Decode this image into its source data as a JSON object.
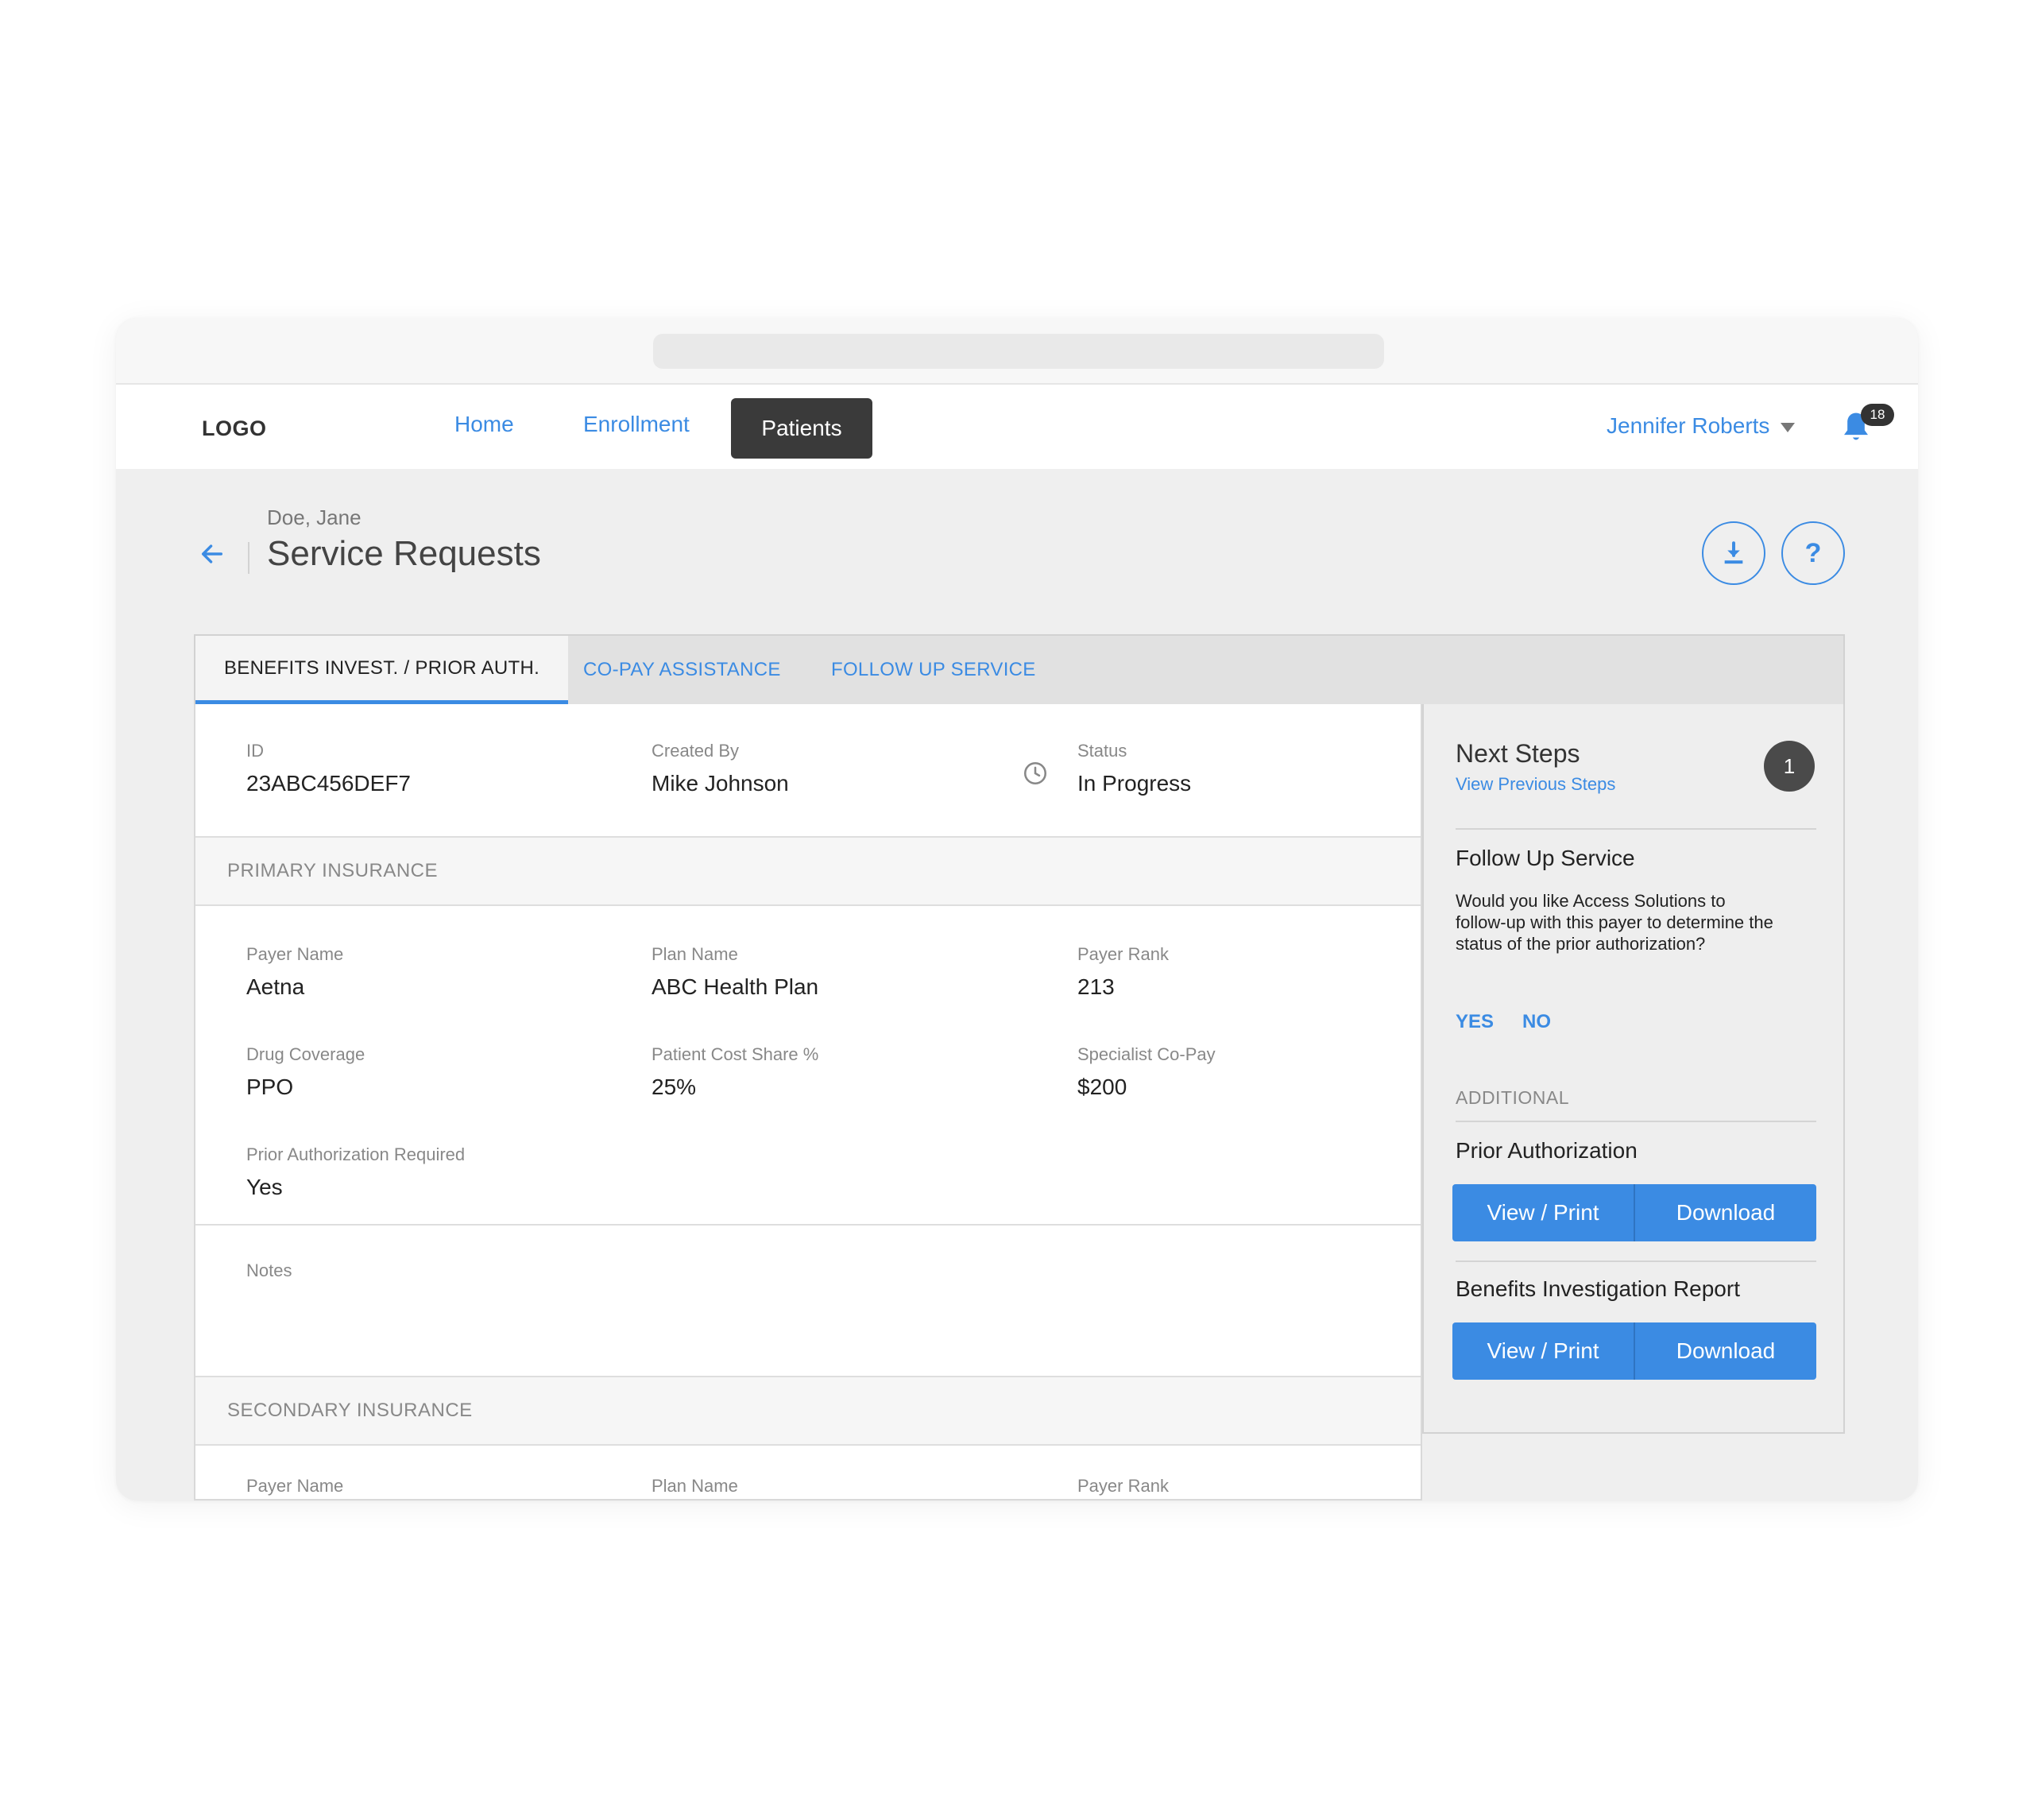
{
  "nav": {
    "logo": "LOGO",
    "links": [
      "Home",
      "Enrollment",
      "Patients"
    ],
    "active": "Patients",
    "user": "Jennifer Roberts",
    "notification_count": "18"
  },
  "header": {
    "breadcrumb": "Doe, Jane",
    "title": "Service Requests"
  },
  "tabs": [
    "BENEFITS INVEST. / PRIOR AUTH.",
    "CO-PAY ASSISTANCE",
    "FOLLOW UP SERVICE"
  ],
  "request": {
    "id_label": "ID",
    "id": "23ABC456DEF7",
    "created_by_label": "Created By",
    "created_by": "Mike Johnson",
    "status_label": "Status",
    "status": "In Progress"
  },
  "primary": {
    "header": "PRIMARY INSURANCE",
    "payer_name_label": "Payer Name",
    "payer_name": "Aetna",
    "plan_name_label": "Plan Name",
    "plan_name": "ABC Health Plan",
    "payer_rank_label": "Payer Rank",
    "payer_rank": "213",
    "drug_coverage_label": "Drug Coverage",
    "drug_coverage": "PPO",
    "cost_share_label": "Patient Cost Share %",
    "cost_share": "25%",
    "copay_label": "Specialist Co-Pay",
    "copay": "$200",
    "prior_auth_label": "Prior Authorization Required",
    "prior_auth": "Yes"
  },
  "notes_label": "Notes",
  "secondary": {
    "header": "SECONDARY INSURANCE",
    "payer_name_label": "Payer Name",
    "plan_name_label": "Plan Name",
    "payer_rank_label": "Payer Rank"
  },
  "side": {
    "title": "Next Steps",
    "view_previous": "View Previous Steps",
    "count": "1",
    "follow_up_title": "Follow Up Service",
    "follow_up_text": "Would you like Access Solutions to follow-up with this payer to determine the status of the prior authorization?",
    "yes": "YES",
    "no": "NO",
    "additional": "ADDITIONAL",
    "docs": [
      {
        "title": "Prior Authorization",
        "view": "View / Print",
        "download": "Download"
      },
      {
        "title": "Benefits Investigation Report",
        "view": "View / Print",
        "download": "Download"
      }
    ]
  },
  "colors": {
    "accent": "#3b8be3",
    "dark": "#3a3a3a"
  }
}
